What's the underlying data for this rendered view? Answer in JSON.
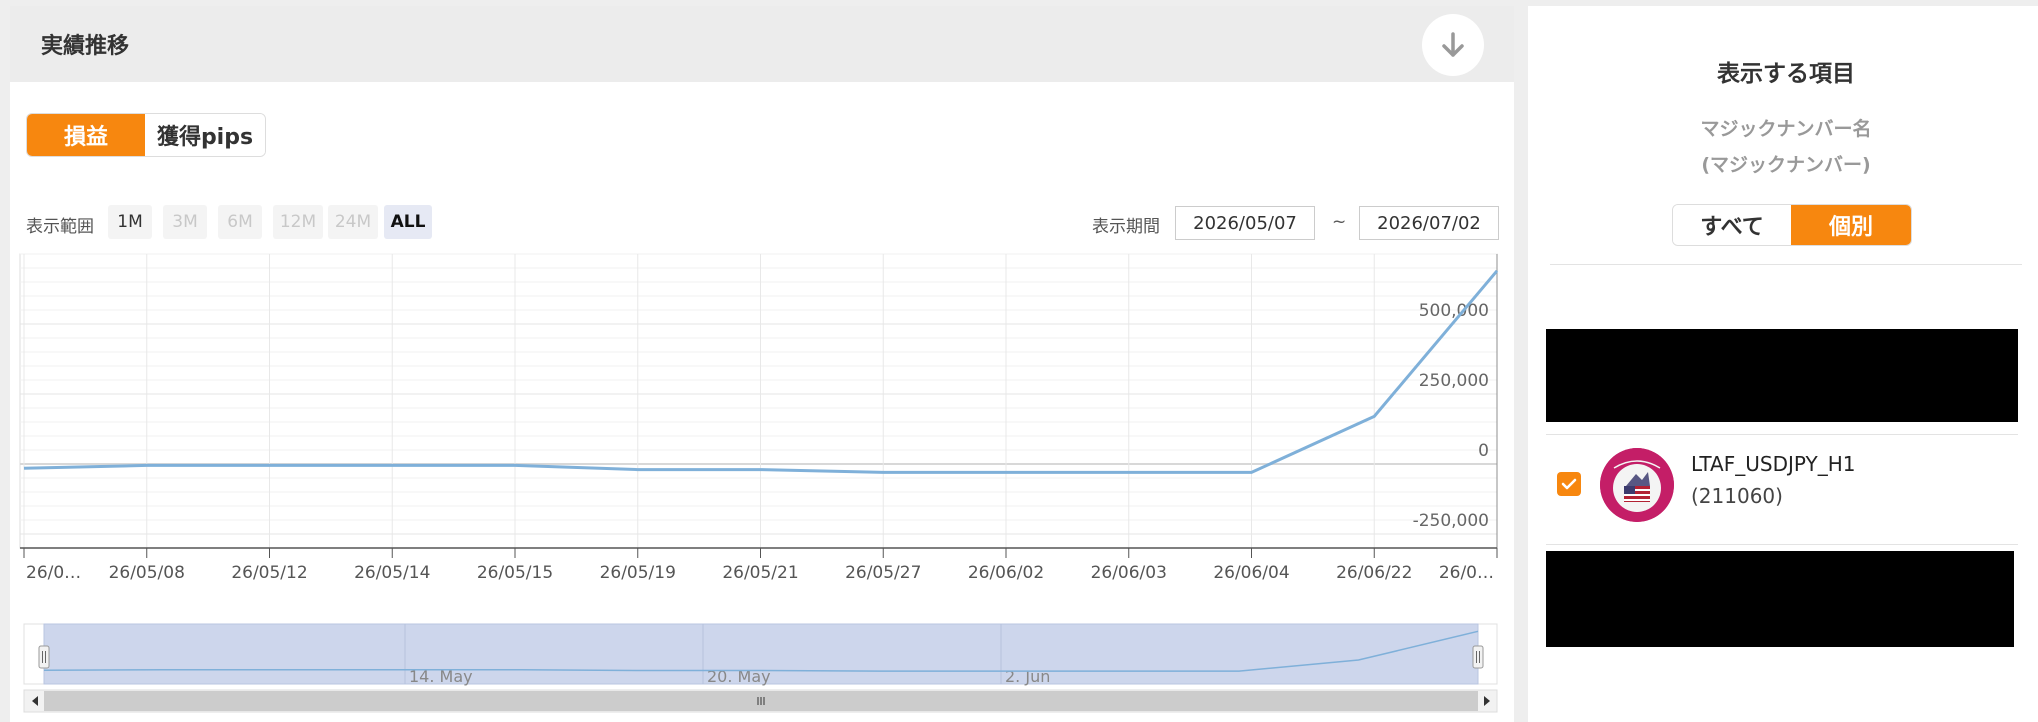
{
  "panel": {
    "title": "実績推移"
  },
  "toggle": {
    "profit_label": "損益",
    "pips_label": "獲得pips"
  },
  "range": {
    "label": "表示範囲",
    "buttons": [
      "1M",
      "3M",
      "6M",
      "12M",
      "24M",
      "ALL"
    ],
    "selected": "ALL"
  },
  "period": {
    "label": "表示期間",
    "start": "2026/05/07",
    "separator": "~",
    "end": "2026/07/02"
  },
  "chart_data": {
    "type": "line",
    "categories": [
      "26/0…",
      "26/05/08",
      "26/05/12",
      "26/05/14",
      "26/05/15",
      "26/05/19",
      "26/05/21",
      "26/05/27",
      "26/06/02",
      "26/06/03",
      "26/06/04",
      "26/06/22",
      "26/0…"
    ],
    "series": [
      {
        "values": [
          -15000,
          -5000,
          -5000,
          -5000,
          -5000,
          -20000,
          -20000,
          -30000,
          -30000,
          -30000,
          -30000,
          170000,
          690000
        ]
      }
    ],
    "y_ticks": [
      -250000,
      0,
      250000,
      500000
    ],
    "y_tick_labels": [
      "-250,000",
      "0",
      "250,000",
      "500,000"
    ],
    "ylim": [
      -300000,
      750000
    ],
    "grid": true,
    "line_color": "#7fb0d9",
    "navigator_labels": [
      "14. May",
      "20. May",
      "2. Jun"
    ],
    "navigator_fill": "#cdd6ec"
  },
  "right": {
    "title": "表示する項目",
    "subtitle1": "マジックナンバー名",
    "subtitle2": "(マジックナンバー)",
    "toggle_all": "すべて",
    "toggle_individual": "個別",
    "ea_name": "LTAF_USDJPY_H1",
    "ea_magic": "(211060)"
  },
  "colors": {
    "accent": "#f7870f",
    "header_bg": "#ececec"
  }
}
